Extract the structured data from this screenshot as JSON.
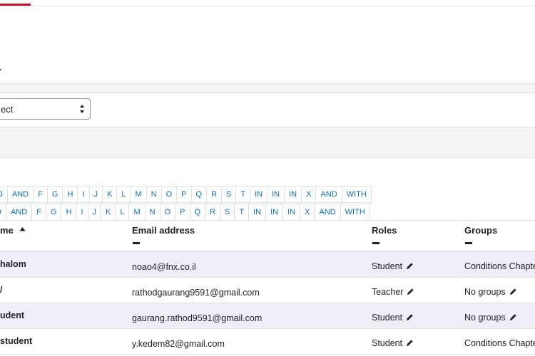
{
  "filter": {
    "selected_value": "ect"
  },
  "letters_row1": [
    "D",
    "AND",
    "F",
    "G",
    "H",
    "I",
    "J",
    "K",
    "L",
    "M",
    "N",
    "O",
    "P",
    "Q",
    "R",
    "S",
    "T",
    "IN",
    "IN",
    "IN",
    "X",
    "AND",
    "WITH"
  ],
  "letters_row2": [
    "D",
    "AND",
    "F",
    "G",
    "H",
    "I",
    "J",
    "K",
    "L",
    "M",
    "N",
    "O",
    "P",
    "Q",
    "R",
    "S",
    "T",
    "IN",
    "IN",
    "IN",
    "X",
    "AND",
    "WITH"
  ],
  "table": {
    "headers": {
      "name": "me",
      "email": "Email address",
      "roles": "Roles",
      "groups": "Groups"
    },
    "rows": [
      {
        "name": "halom",
        "email": "noao4@fnx.co.il",
        "role": "Student",
        "groups": "Conditions Chapte"
      },
      {
        "name": "/",
        "email": "rathodgaurang9591@gmail.com",
        "role": "Teacher",
        "groups": "No groups"
      },
      {
        "name": "udent",
        "email": "gaurang.rathod9591@gmail.com",
        "role": "Student",
        "groups": "No groups"
      },
      {
        "name": "student",
        "email": "y.kedem82@gmail.com",
        "role": "Student",
        "groups": "Conditions Chapte"
      }
    ]
  },
  "icons": {
    "sort": "sort-asc-icon",
    "edit": "pencil-icon",
    "select": "select-arrows-icon"
  },
  "colors": {
    "accent": "#c8102e",
    "link": "#0f6cbf",
    "stripe": "#f0eef9"
  }
}
